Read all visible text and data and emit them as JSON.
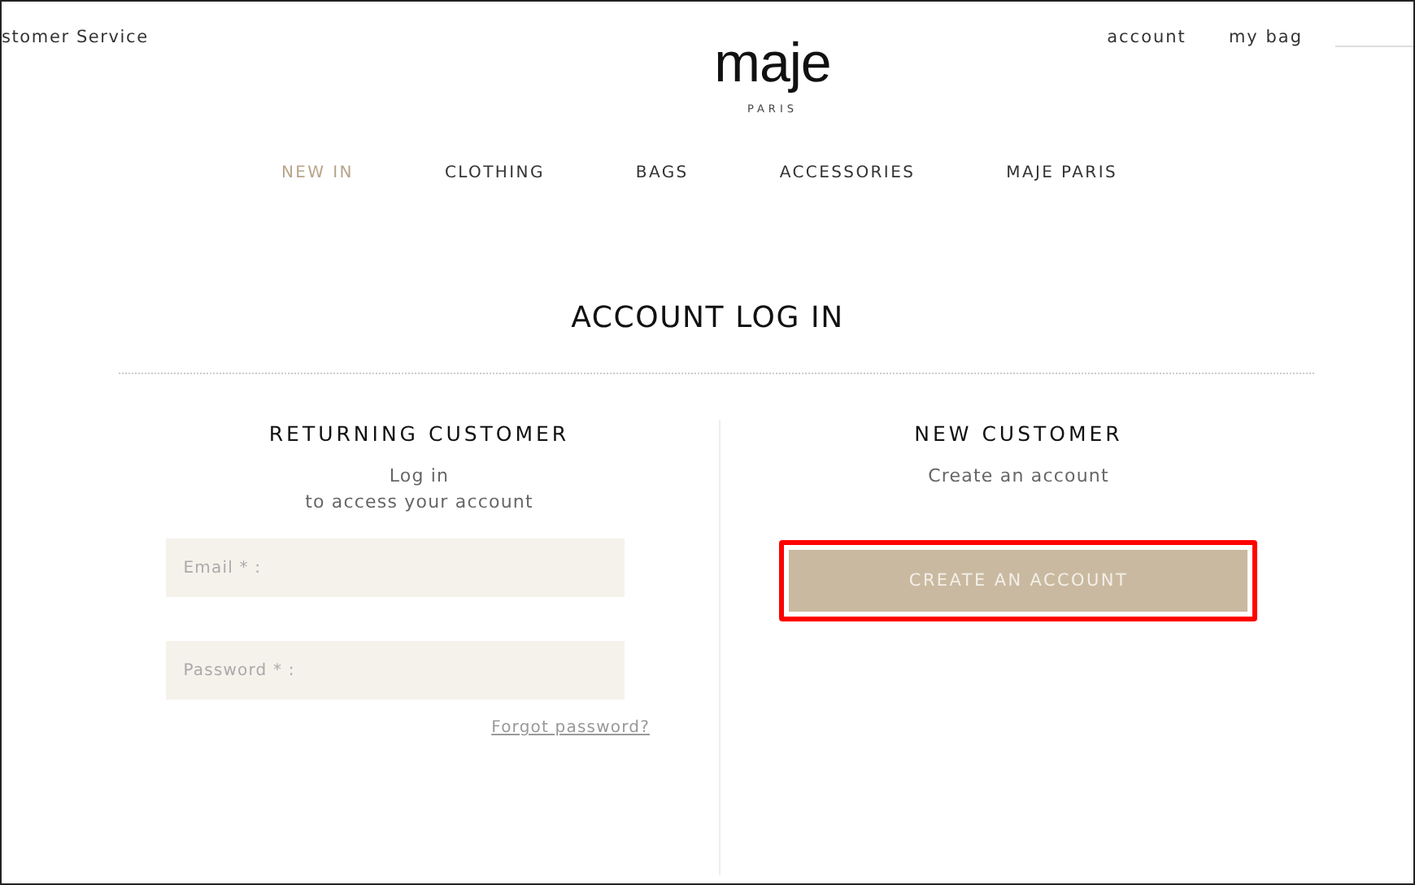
{
  "top_bar": {
    "customer_service": "stomer Service",
    "links": [
      "account",
      "my bag"
    ]
  },
  "logo": {
    "name": "maje",
    "subtitle": "PARIS"
  },
  "nav": [
    {
      "label": "NEW IN",
      "selected": true
    },
    {
      "label": "CLOTHING",
      "selected": false
    },
    {
      "label": "BAGS",
      "selected": false
    },
    {
      "label": "ACCESSORIES",
      "selected": false
    },
    {
      "label": "MAJE PARIS",
      "selected": false
    }
  ],
  "title": "ACCOUNT LOG IN",
  "returning": {
    "heading": "RETURNING CUSTOMER",
    "lines": [
      "Log in",
      "to access your account"
    ],
    "email": {
      "placeholder": "Email * :"
    },
    "password": {
      "placeholder": "Password * :"
    },
    "forgot": "Forgot password?"
  },
  "new_customer": {
    "heading": "NEW CUSTOMER",
    "text": "Create an account",
    "button": {
      "label": "CREATE AN ACCOUNT",
      "highlighted": true
    }
  }
}
